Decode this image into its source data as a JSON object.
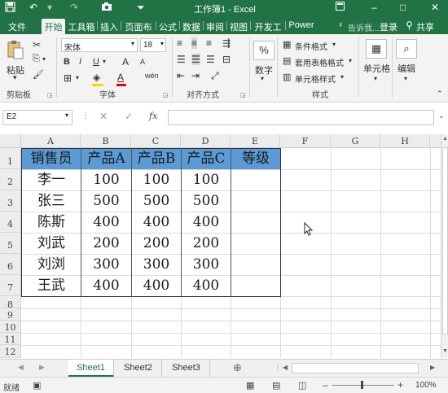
{
  "window": {
    "title": "工作簿1 - Excel",
    "qa_save_icon": "save-icon",
    "qa_undo_icon": "undo-icon",
    "qa_redo_icon": "redo-icon",
    "qa_camera_icon": "camera-icon",
    "qa_custom_icon": "customize-qa-icon",
    "controls": [
      "restore",
      "minimize",
      "maximize",
      "close"
    ]
  },
  "tabs": [
    "文件",
    "开始",
    "工具箱",
    "插入",
    "页面布",
    "公式",
    "数据",
    "审阅",
    "视图",
    "开发工",
    "Power"
  ],
  "active_tab": "开始",
  "tell_me": "告诉我...",
  "login": "登录",
  "share": "共享",
  "ribbon": {
    "clipboard": {
      "label": "剪贴板",
      "paste": "粘贴"
    },
    "font": {
      "label": "字体",
      "font_name": "宋体",
      "font_size": "18",
      "bold": "B",
      "italic": "I",
      "underline": "U",
      "grow": "A",
      "shrink": "A",
      "phonetic": "wén"
    },
    "alignment": {
      "label": "对齐方式"
    },
    "number": {
      "label": "数字",
      "percent": "%"
    },
    "styles": {
      "label": "样式",
      "conditional": "条件格式",
      "table_format": "套用表格格式",
      "cell_styles": "单元格样式"
    },
    "cells": {
      "label": "单元格"
    },
    "editing": {
      "label": "编辑"
    }
  },
  "formula_bar": {
    "name_box": "E2",
    "fx": "fx",
    "cancel": "✕",
    "confirm": "✓",
    "value": ""
  },
  "columns": [
    "A",
    "B",
    "C",
    "D",
    "E",
    "F",
    "G",
    "H"
  ],
  "rows": [
    "1",
    "2",
    "3",
    "4",
    "5",
    "6",
    "7",
    "8",
    "9",
    "10",
    "11",
    "12"
  ],
  "table": {
    "headers": [
      "销售员",
      "产品A",
      "产品B",
      "产品C",
      "等级"
    ],
    "data": [
      [
        "李一",
        "100",
        "100",
        "100",
        ""
      ],
      [
        "张三",
        "500",
        "500",
        "500",
        ""
      ],
      [
        "陈斯",
        "400",
        "400",
        "400",
        ""
      ],
      [
        "刘武",
        "200",
        "200",
        "200",
        ""
      ],
      [
        "刘浏",
        "300",
        "300",
        "300",
        ""
      ],
      [
        "王武",
        "400",
        "400",
        "400",
        ""
      ]
    ]
  },
  "sheet_tabs": [
    "Sheet1",
    "Sheet2",
    "Sheet3"
  ],
  "active_sheet": "Sheet1",
  "status": {
    "mode": "就绪",
    "zoom": "100%"
  },
  "colors": {
    "brand": "#217346",
    "header_fill": "#5b9bd5"
  }
}
